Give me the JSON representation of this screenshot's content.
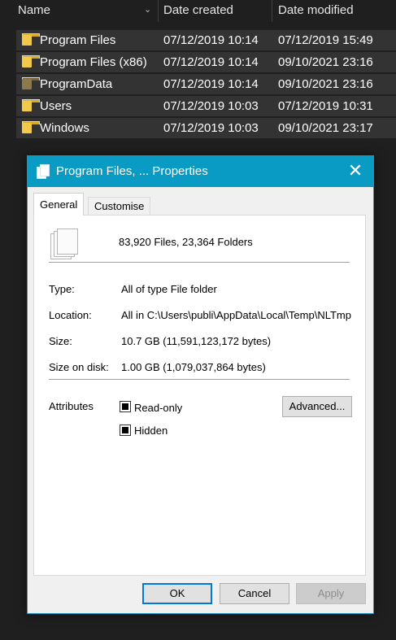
{
  "explorer": {
    "columns": {
      "name": "Name",
      "created": "Date created",
      "modified": "Date modified"
    },
    "rows": [
      {
        "name": "Program Files",
        "created": "07/12/2019 10:14",
        "modified": "07/12/2019 15:49"
      },
      {
        "name": "Program Files (x86)",
        "created": "07/12/2019 10:14",
        "modified": "09/10/2021 23:16"
      },
      {
        "name": "ProgramData",
        "created": "07/12/2019 10:14",
        "modified": "09/10/2021 23:16"
      },
      {
        "name": "Users",
        "created": "07/12/2019 10:03",
        "modified": "07/12/2019 10:31"
      },
      {
        "name": "Windows",
        "created": "07/12/2019 10:03",
        "modified": "09/10/2021 23:17"
      }
    ]
  },
  "dialog": {
    "title": "Program Files, ... Properties",
    "close_glyph": "✕",
    "tabs": {
      "general": "General",
      "customise": "Customise"
    },
    "summary": "83,920 Files, 23,364 Folders",
    "fields": {
      "type_label": "Type:",
      "type_value": "All of type File folder",
      "location_label": "Location:",
      "location_value": "All in C:\\Users\\publi\\AppData\\Local\\Temp\\NLTmp",
      "size_label": "Size:",
      "size_value": "10.7 GB (11,591,123,172 bytes)",
      "disk_label": "Size on disk:",
      "disk_value": "1.00 GB (1,079,037,864 bytes)"
    },
    "attributes": {
      "label": "Attributes",
      "readonly": "Read-only",
      "hidden": "Hidden",
      "advanced": "Advanced..."
    },
    "buttons": {
      "ok": "OK",
      "cancel": "Cancel",
      "apply": "Apply"
    },
    "accent_color": "#0a9bc4"
  }
}
